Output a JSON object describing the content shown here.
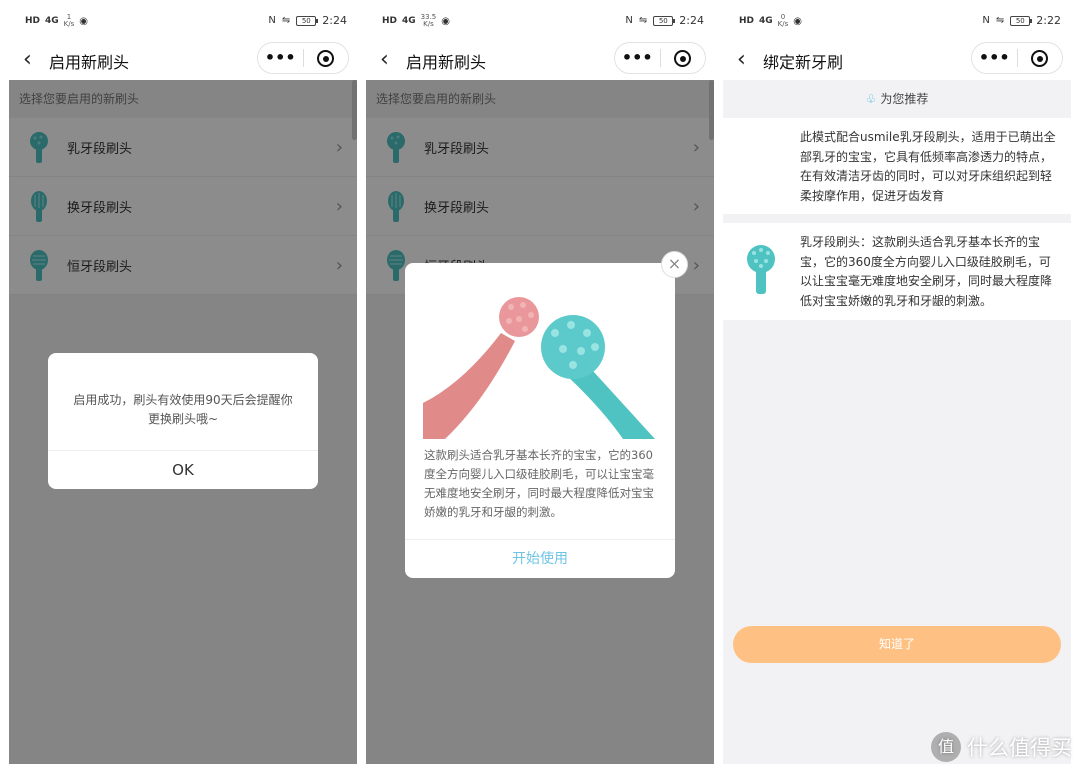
{
  "status_bars": [
    {
      "sig": "HD",
      "net": "4G",
      "speed_value": "1",
      "speed_unit": "K/s",
      "batt": "50",
      "time": "2:24"
    },
    {
      "sig": "HD",
      "net": "4G",
      "speed_value": "33.5",
      "speed_unit": "K/s",
      "batt": "50",
      "time": "2:24"
    },
    {
      "sig": "HD",
      "net": "4G",
      "speed_value": "0",
      "speed_unit": "K/s",
      "batt": "50",
      "time": "2:22"
    }
  ],
  "screen1": {
    "title": "启用新刷头",
    "section_header": "选择您要启用的新刷头",
    "items": [
      {
        "label": "乳牙段刷头"
      },
      {
        "label": "换牙段刷头"
      },
      {
        "label": "恒牙段刷头"
      }
    ],
    "dialog": {
      "message": "启用成功，刷头有效使用90天后会提醒你更换刷头哦~",
      "ok_label": "OK"
    }
  },
  "screen2": {
    "title": "启用新刷头",
    "section_header": "选择您要启用的新刷头",
    "items": [
      {
        "label": "乳牙段刷头"
      },
      {
        "label": "换牙段刷头"
      },
      {
        "label": "恒牙段刷头"
      }
    ],
    "dialog": {
      "description": "这款刷头适合乳牙基本长齐的宝宝，它的360度全方向婴儿入口级硅胶刷毛，可以让宝宝毫无难度地安全刷牙，同时最大程度降低对宝宝娇嫩的乳牙和牙龈的刺激。",
      "start_label": "开始使用",
      "close_symbol": "×"
    }
  },
  "screen3": {
    "title": "绑定新牙刷",
    "rec_header": "为您推荐",
    "mode_desc": "此模式配合usmile乳牙段刷头，适用于已萌出全部乳牙的宝宝，它具有低频率高渗透力的特点，在有效清洁牙齿的同时，可以对牙床组织起到轻柔按摩作用，促进牙齿发育",
    "brush_desc": "乳牙段刷头：这款刷头适合乳牙基本长齐的宝宝，它的360度全方向婴儿入口级硅胶刷毛，可以让宝宝毫无难度地安全刷牙，同时最大程度降低对宝宝娇嫩的乳牙和牙龈的刺激。",
    "button_label": "知道了"
  },
  "nav": {
    "back_symbol": "‹",
    "more_symbol": "•••"
  },
  "watermark": {
    "logo": "值",
    "text": "什么值得买"
  },
  "colors": {
    "brush_teal": "#4fc2c2",
    "brush_pink": "#e08a8a",
    "accent_blue": "#6fc4e6",
    "orange_button": "#ffc183"
  }
}
